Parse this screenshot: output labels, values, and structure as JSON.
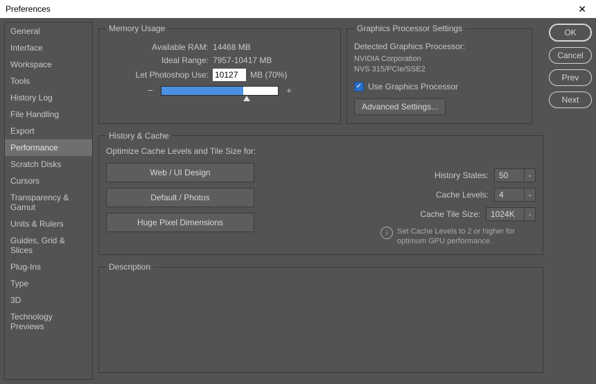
{
  "window": {
    "title": "Preferences"
  },
  "sidebar": {
    "items": [
      "General",
      "Interface",
      "Workspace",
      "Tools",
      "History Log",
      "File Handling",
      "Export",
      "Performance",
      "Scratch Disks",
      "Cursors",
      "Transparency & Gamut",
      "Units & Rulers",
      "Guides, Grid & Slices",
      "Plug-Ins",
      "Type",
      "3D",
      "Technology Previews"
    ],
    "selected": 7
  },
  "actions": {
    "ok": "OK",
    "cancel": "Cancel",
    "prev": "Prev",
    "next": "Next"
  },
  "memory": {
    "legend": "Memory Usage",
    "available_label": "Available RAM:",
    "available_value": "14468 MB",
    "ideal_label": "Ideal Range:",
    "ideal_value": "7957-10417 MB",
    "use_label": "Let Photoshop Use:",
    "use_value": "10127",
    "use_suffix": "MB (70%)",
    "minus": "−",
    "plus": "+"
  },
  "gpu": {
    "legend": "Graphics Processor Settings",
    "detected_label": "Detected Graphics Processor:",
    "vendor": "NVIDIA Corporation",
    "device": "NVS 315/PCIe/SSE2",
    "use_label": "Use Graphics Processor",
    "advanced": "Advanced Settings..."
  },
  "history": {
    "legend": "History & Cache",
    "optimize_label": "Optimize Cache Levels and Tile Size for:",
    "presets": [
      "Web / UI Design",
      "Default / Photos",
      "Huge Pixel Dimensions"
    ],
    "states_label": "History States:",
    "states_value": "50",
    "levels_label": "Cache Levels:",
    "levels_value": "4",
    "tile_label": "Cache Tile Size:",
    "tile_value": "1024K",
    "info": "Set Cache Levels to 2 or higher for optimum GPU performance."
  },
  "description": {
    "legend": "Description"
  }
}
